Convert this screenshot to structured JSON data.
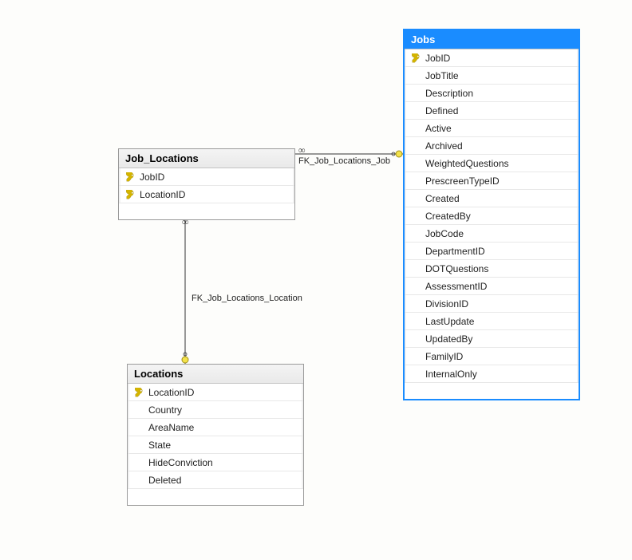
{
  "entities": {
    "job_locations": {
      "title": "Job_Locations",
      "columns": [
        {
          "name": "JobID",
          "pk": true
        },
        {
          "name": "LocationID",
          "pk": true
        }
      ]
    },
    "locations": {
      "title": "Locations",
      "columns": [
        {
          "name": "LocationID",
          "pk": true
        },
        {
          "name": "Country",
          "pk": false
        },
        {
          "name": "AreaName",
          "pk": false
        },
        {
          "name": "State",
          "pk": false
        },
        {
          "name": "HideConviction",
          "pk": false
        },
        {
          "name": "Deleted",
          "pk": false
        }
      ]
    },
    "jobs": {
      "title": "Jobs",
      "columns": [
        {
          "name": "JobID",
          "pk": true
        },
        {
          "name": "JobTitle",
          "pk": false
        },
        {
          "name": "Description",
          "pk": false
        },
        {
          "name": "Defined",
          "pk": false
        },
        {
          "name": "Active",
          "pk": false
        },
        {
          "name": "Archived",
          "pk": false
        },
        {
          "name": "WeightedQuestions",
          "pk": false
        },
        {
          "name": "PrescreenTypeID",
          "pk": false
        },
        {
          "name": "Created",
          "pk": false
        },
        {
          "name": "CreatedBy",
          "pk": false
        },
        {
          "name": "JobCode",
          "pk": false
        },
        {
          "name": "DepartmentID",
          "pk": false
        },
        {
          "name": "DOTQuestions",
          "pk": false
        },
        {
          "name": "AssessmentID",
          "pk": false
        },
        {
          "name": "DivisionID",
          "pk": false
        },
        {
          "name": "LastUpdate",
          "pk": false
        },
        {
          "name": "UpdatedBy",
          "pk": false
        },
        {
          "name": "FamilyID",
          "pk": false
        },
        {
          "name": "InternalOnly",
          "pk": false
        }
      ]
    }
  },
  "relationships": {
    "to_jobs": {
      "label": "FK_Job_Locations_Job"
    },
    "to_locations": {
      "label": "FK_Job_Locations_Location"
    }
  }
}
